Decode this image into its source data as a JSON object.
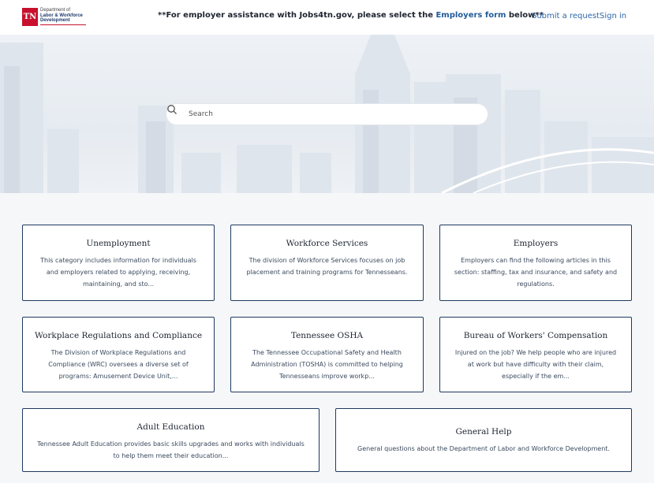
{
  "header": {
    "logo_badge": "TN",
    "logo_line1": "Department of",
    "logo_line2": "Labor & Workforce",
    "logo_line3": "Development",
    "notice_prefix": "**For employer assistance with Jobs4tn.gov, please select the ",
    "notice_link": "Employers form",
    "notice_suffix": " below**",
    "submit_request": "Submit a request",
    "sign_in": "Sign in"
  },
  "search": {
    "placeholder": "Search"
  },
  "categories": [
    {
      "title": "Unemployment",
      "description": "This category includes information for individuals and employers related to applying, receiving, maintaining, and sto..."
    },
    {
      "title": "Workforce Services",
      "description": "The division of Workforce Services focuses on job placement and training programs for Tennesseans."
    },
    {
      "title": "Employers",
      "description": "Employers can find the following articles in this section: staffing, tax and insurance, and safety and regulations."
    },
    {
      "title": "Workplace Regulations and Compliance",
      "description": "The Division of Workplace Regulations and Compliance (WRC) oversees a diverse set of programs: Amusement Device Unit,..."
    },
    {
      "title": "Tennessee OSHA",
      "description": "The Tennessee Occupational Safety and Health Administration (TOSHA) is committed to helping Tennesseans improve workp..."
    },
    {
      "title": "Bureau of Workers' Compensation",
      "description": "Injured on the job? We help people who are injured at work but have difficulty with their claim, especially if the em..."
    },
    {
      "title": "Adult Education",
      "description": "Tennessee Adult Education provides basic skills upgrades and works with individuals to help them meet their education..."
    },
    {
      "title": "General Help",
      "description": "General questions about the Department of Labor and Workforce Development."
    }
  ],
  "colors": {
    "accent": "#1f5a99",
    "brand_red": "#c8102e",
    "card_border": "#1f3a5f"
  }
}
